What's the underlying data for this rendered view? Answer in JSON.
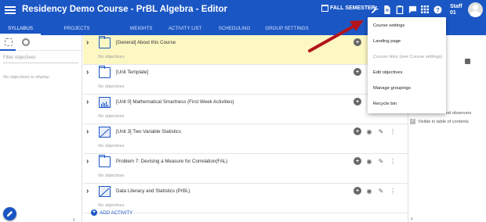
{
  "app": {
    "title": "Residency Demo Course - PrBL Algebra - Editor",
    "semester": "FALL SEMESTER",
    "user_line1": "Staff",
    "user_line2": "01"
  },
  "tabs": [
    {
      "label": "SYLLABUS",
      "active": true
    },
    {
      "label": "PROJECTS",
      "active": false
    },
    {
      "label": "WEIGHTS",
      "active": false
    },
    {
      "label": "ACTIVITY LIST",
      "active": false
    },
    {
      "label": "SCHEDULING",
      "active": false
    },
    {
      "label": "GROUP SETTINGS",
      "active": false
    }
  ],
  "sidebar": {
    "filter_placeholder": "Filter objectives",
    "empty_text": "No objectives to display"
  },
  "main": {
    "rows": [
      {
        "title": "[General] About this Course",
        "objectives": "No objectives",
        "icon": "folder-icon",
        "highlight": true
      },
      {
        "title": "[Unit Template]",
        "objectives": "No objectives",
        "icon": "folder-icon",
        "highlight": false
      },
      {
        "title": "[Unit 0] Mathematical Smartness (First Week Activities)",
        "objectives": "No objectives",
        "icon": "bar-chart-icon",
        "highlight": false
      },
      {
        "title": "[Unit 3] Two Variable Statistics",
        "objectives": "No objectives",
        "icon": "line-chart-icon",
        "highlight": false
      },
      {
        "title": "Problem 7: Devising a Measure for Correlation(FAL)",
        "objectives": "No objectives",
        "icon": "folder-icon",
        "highlight": false
      },
      {
        "title": "Data Literacy and Statistics (PrBL)",
        "objectives": "No objectives",
        "icon": "line-chart-icon",
        "highlight": false
      }
    ],
    "add_activity": "ADD ACTIVITY"
  },
  "right_panel": {
    "text1": "nd observers",
    "checkbox_label": "Visible in table of contents"
  },
  "dropdown": {
    "items": [
      {
        "label": "Course settings",
        "disabled": false
      },
      {
        "label": "Landing page",
        "disabled": false
      },
      {
        "label": "Course links (see Course settings)",
        "disabled": true
      },
      {
        "label": "Edit objectives",
        "disabled": false
      },
      {
        "label": "Manage groupings",
        "disabled": false
      },
      {
        "label": "Recycle bin",
        "disabled": false
      }
    ]
  },
  "colors": {
    "primary": "#1a56c4",
    "highlight_row": "#fdf7c3",
    "arrow": "#b3141b"
  }
}
